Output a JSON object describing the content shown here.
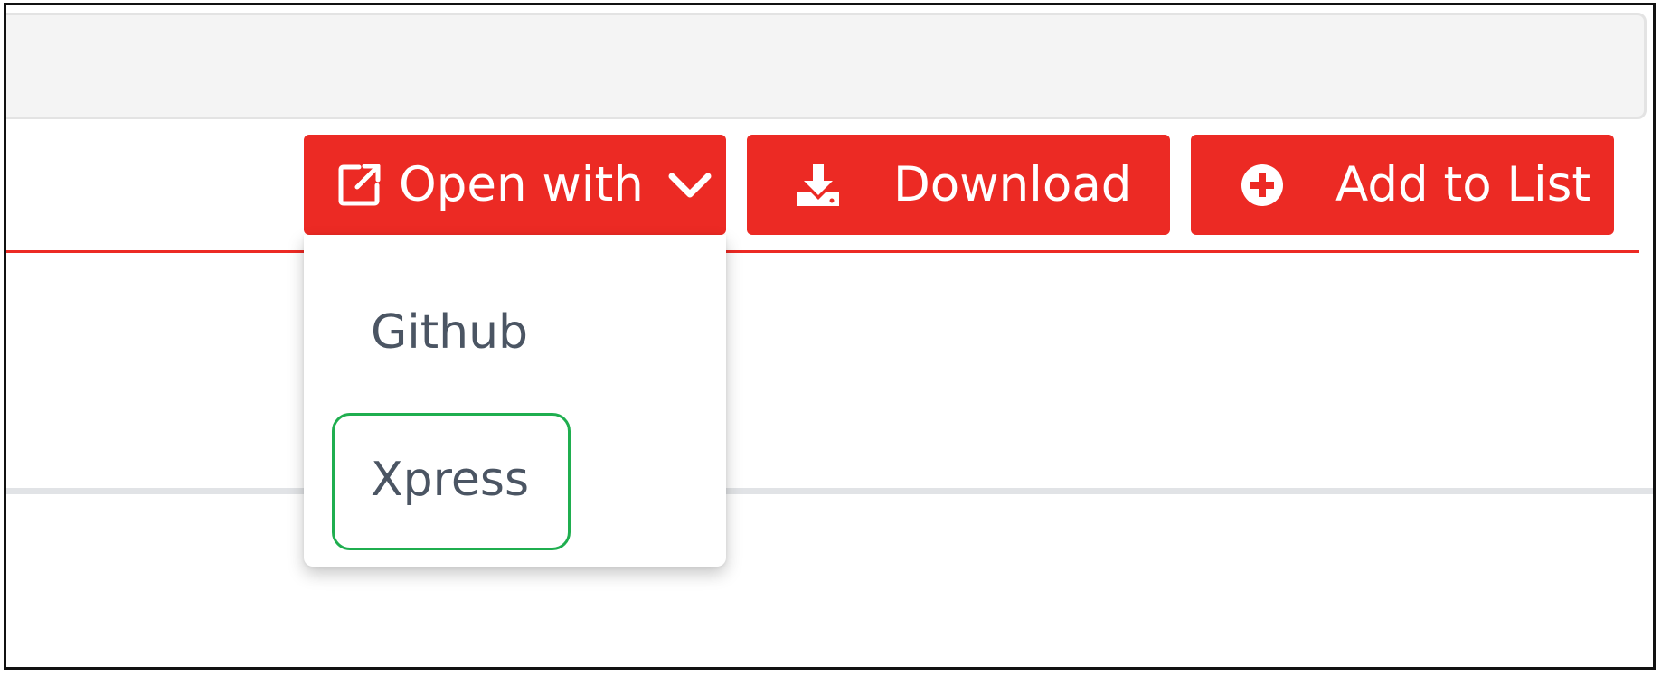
{
  "toolbar": {
    "open_with_label": "Open with",
    "download_label": "Download",
    "add_to_list_label": "Add to List"
  },
  "open_with_menu": {
    "items": [
      {
        "label": "Github"
      },
      {
        "label": "Xpress"
      }
    ],
    "highlighted_item": "Xpress"
  },
  "colors": {
    "accent": "#ec2a24",
    "highlight": "#1fae4f",
    "menu_text": "#4b5563",
    "top_bar": "#f4f4f4"
  },
  "icons": {
    "open_with": "external-link-icon",
    "dropdown": "chevron-down-icon",
    "download": "download-icon",
    "add_to_list": "plus-circle-icon"
  }
}
